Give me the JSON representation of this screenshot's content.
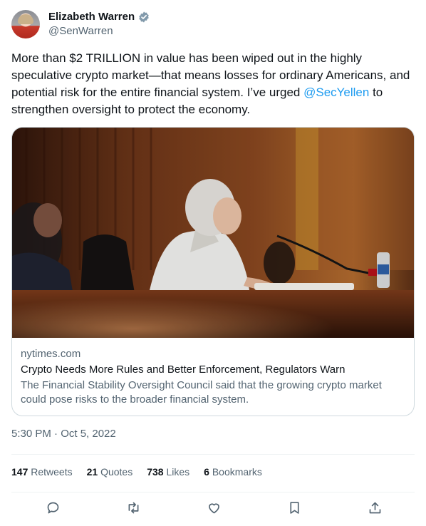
{
  "author": {
    "display_name": "Elizabeth Warren",
    "handle": "@SenWarren",
    "verified_icon": "verified-badge-icon"
  },
  "tweet": {
    "text_before": "More than $2 TRILLION in value has been wiped out in the highly speculative crypto market—that means losses for ordinary Americans, and potential risk for the entire financial system. I’ve urged ",
    "mention": "@SecYellen",
    "text_after": " to strengthen oversight to protect the economy."
  },
  "card": {
    "domain": "nytimes.com",
    "title": "Crypto Needs More Rules and Better Enforcement, Regulators Warn",
    "description": "The Financial Stability Oversight Council said that the growing crypto market could pose risks to the broader financial system."
  },
  "timestamp": "5:30 PM · Oct 5, 2022",
  "stats": {
    "retweets_count": "147",
    "retweets_label": "Retweets",
    "quotes_count": "21",
    "quotes_label": "Quotes",
    "likes_count": "738",
    "likes_label": "Likes",
    "bookmarks_count": "6",
    "bookmarks_label": "Bookmarks"
  },
  "actions": [
    "reply-icon",
    "retweet-icon",
    "like-icon",
    "bookmark-icon",
    "share-icon"
  ],
  "colors": {
    "link": "#1d9bf0",
    "secondary": "#536471",
    "border": "#cfd9de"
  }
}
